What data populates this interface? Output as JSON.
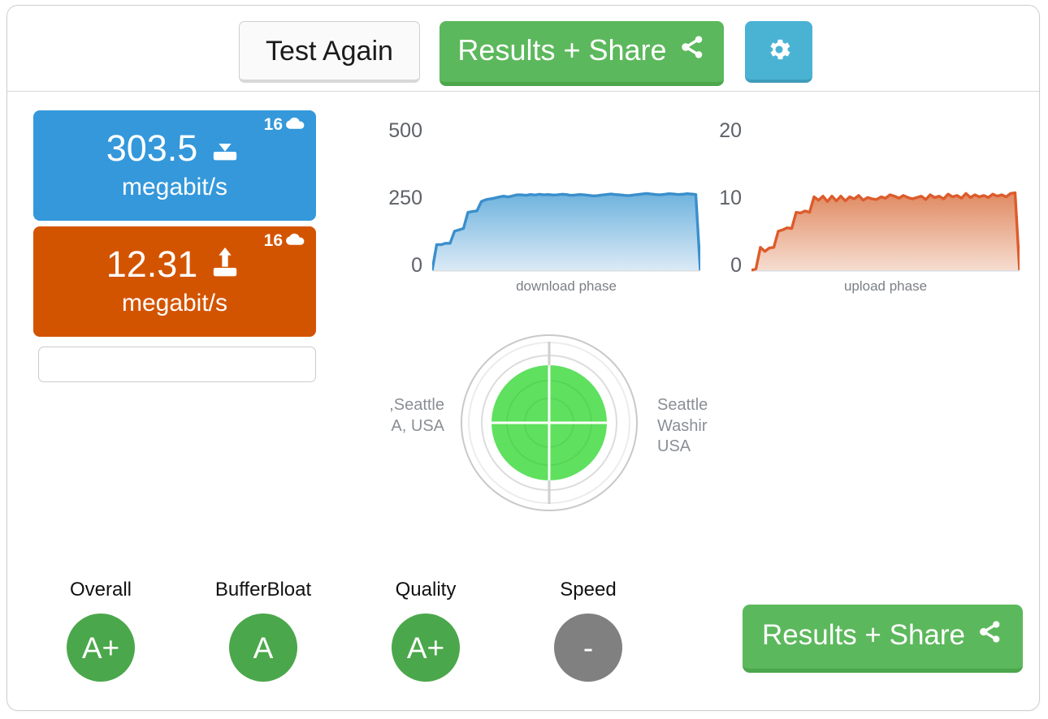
{
  "toolbar": {
    "test_again_label": "Test Again",
    "results_share_label": "Results + Share",
    "share_icon": "share-icon",
    "settings_icon": "gear-icon"
  },
  "speed_cards": [
    {
      "kind": "download",
      "value": "303.5",
      "unit": "megabit/s",
      "badge_count": "16",
      "badge_icon": "cloud-icon",
      "direction_icon": "download-arrow-icon",
      "color": "#3498db"
    },
    {
      "kind": "upload",
      "value": "12.31",
      "unit": "megabit/s",
      "badge_count": "16",
      "badge_icon": "cloud-icon",
      "direction_icon": "upload-arrow-icon",
      "color": "#d35400"
    }
  ],
  "note_box": {
    "value": "",
    "placeholder": ""
  },
  "location": {
    "left_label_lines": [
      "Seattle,",
      "A, USA"
    ],
    "right_label_lines": [
      "Seattle",
      "Washir",
      "USA"
    ],
    "radar_fill_color": "#5fe05f"
  },
  "grades": [
    {
      "label": "Overall",
      "value": "A+",
      "color": "#4ba74b",
      "state": "green"
    },
    {
      "label": "BufferBloat",
      "value": "A",
      "color": "#4ba74b",
      "state": "green"
    },
    {
      "label": "Quality",
      "value": "A+",
      "color": "#4ba74b",
      "state": "green"
    },
    {
      "label": "Speed",
      "value": "-",
      "color": "#808080",
      "state": "grey"
    }
  ],
  "footer": {
    "results_share_label": "Results + Share",
    "share_icon": "share-icon"
  },
  "chart_data": [
    {
      "type": "area",
      "title": "",
      "xlabel": "download phase",
      "ylabel": "",
      "ylim": [
        0,
        500
      ],
      "yticks": [
        0,
        250,
        500
      ],
      "ytick_labels": [
        "0",
        "250",
        "500"
      ],
      "grid": false,
      "legend": "none",
      "line_color": "#3a8fcc",
      "fill_color": "#a8cfe8",
      "x": [
        0,
        1,
        2,
        3,
        4,
        5,
        6,
        7,
        8,
        9,
        10,
        11,
        12,
        13,
        14,
        15,
        16,
        17,
        18,
        19,
        20,
        21,
        22,
        23,
        24,
        25,
        26,
        27,
        28,
        29,
        30,
        31,
        32,
        33,
        34,
        35,
        36,
        37,
        38,
        39,
        40,
        41,
        42,
        43,
        44,
        45,
        46,
        47,
        48,
        49,
        50,
        51,
        52,
        53,
        54,
        55,
        56,
        57,
        58,
        59,
        60
      ],
      "values": [
        0,
        95,
        95,
        100,
        100,
        145,
        150,
        155,
        215,
        218,
        220,
        255,
        262,
        265,
        268,
        272,
        275,
        272,
        276,
        280,
        280,
        278,
        281,
        279,
        282,
        280,
        281,
        279,
        280,
        282,
        281,
        278,
        279,
        281,
        280,
        278,
        276,
        277,
        279,
        281,
        283,
        281,
        280,
        278,
        277,
        279,
        281,
        283,
        285,
        283,
        281,
        280,
        282,
        284,
        283,
        281,
        282,
        284,
        283,
        281,
        0
      ]
    },
    {
      "type": "area",
      "title": "",
      "xlabel": "upload phase",
      "ylabel": "",
      "ylim": [
        0,
        20
      ],
      "yticks": [
        0,
        10,
        20
      ],
      "ytick_labels": [
        "0",
        "10",
        "20"
      ],
      "grid": false,
      "legend": "none",
      "line_color": "#dd5b2b",
      "fill_color": "#edb39a",
      "x": [
        0,
        1,
        2,
        3,
        4,
        5,
        6,
        7,
        8,
        9,
        10,
        11,
        12,
        13,
        14,
        15,
        16,
        17,
        18,
        19,
        20,
        21,
        22,
        23,
        24,
        25,
        26,
        27,
        28,
        29,
        30,
        31,
        32,
        33,
        34,
        35,
        36,
        37,
        38,
        39,
        40,
        41,
        42,
        43,
        44,
        45,
        46,
        47,
        48,
        49,
        50,
        51,
        52,
        53,
        54,
        55,
        56,
        57,
        58,
        59,
        60
      ],
      "values": [
        0,
        0.2,
        3.4,
        2.8,
        3.3,
        3.4,
        5.8,
        6.0,
        6.3,
        6.2,
        8.6,
        8.5,
        8.8,
        8.6,
        10.9,
        10.4,
        11.0,
        10.2,
        11.0,
        10.3,
        11.0,
        10.3,
        10.9,
        10.6,
        11.1,
        10.4,
        10.8,
        10.6,
        10.5,
        10.9,
        10.7,
        11.2,
        11.0,
        10.7,
        11.1,
        10.8,
        10.6,
        10.8,
        11.0,
        10.5,
        11.2,
        10.8,
        11.0,
        10.6,
        11.3,
        10.9,
        11.1,
        10.7,
        11.4,
        10.8,
        11.2,
        10.9,
        11.1,
        10.8,
        11.3,
        11.0,
        11.2,
        10.9,
        11.4,
        11.5,
        0
      ]
    }
  ]
}
